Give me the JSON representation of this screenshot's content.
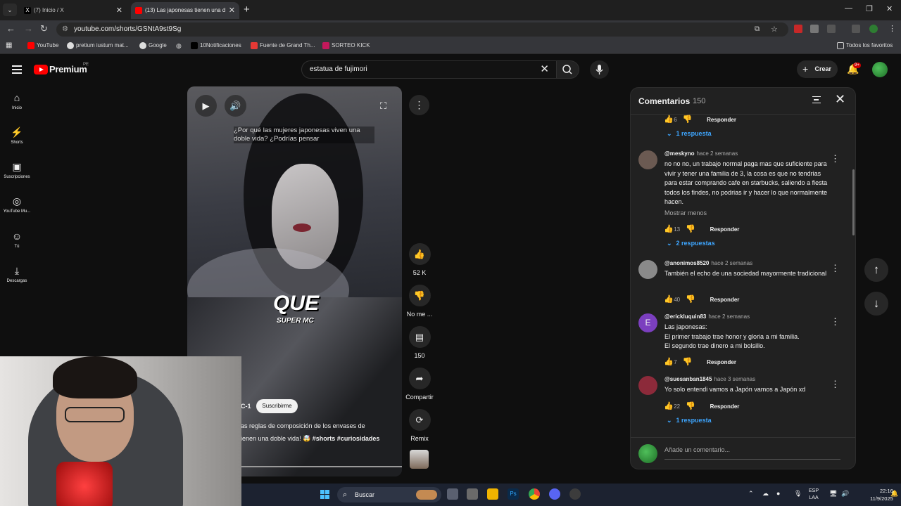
{
  "browser": {
    "tabs": [
      {
        "title": "(7) Inicio / X",
        "active": false
      },
      {
        "title": "(13) Las japonesas tienen una d",
        "active": true
      }
    ],
    "url": "youtube.com/shorts/GSNtA9st9Sg",
    "bookmarks": [
      "YouTube",
      "pretium iustum mat...",
      "Google",
      "10Notificaciones",
      "Fuente de Grand Th...",
      "SORTEO KICK"
    ],
    "all_bookmarks": "Todos los favoritos"
  },
  "youtube": {
    "brand": "Premium",
    "brand_region": "PE",
    "search_value": "estatua de fujimori",
    "create_label": "Crear",
    "notifications_badge": "9+",
    "sidebar": [
      {
        "label": "Inicio",
        "icon": "home-icon"
      },
      {
        "label": "Shorts",
        "icon": "shorts-icon"
      },
      {
        "label": "Suscripciones",
        "icon": "subscriptions-icon"
      },
      {
        "label": "YouTube Mu...",
        "icon": "music-icon"
      },
      {
        "label": "Tú",
        "icon": "you-icon"
      },
      {
        "label": "Descargas",
        "icon": "download-icon"
      }
    ]
  },
  "short": {
    "caption": "¿Por qué las mujeres japonesas viven una doble vida? ¿Podrías pensar",
    "overlay_big": "QUE",
    "overlay_small": "SUPER MC",
    "channel": "C-1",
    "subscribe": "Suscribirme",
    "description": "as reglas de composición de los envases de",
    "description2": "ienen una doble vida! 🤯",
    "hashtags": "#shorts #curiosidades",
    "actions": {
      "likes": "52 K",
      "dislike": "No me ...",
      "comments": "150",
      "share": "Compartir",
      "remix": "Remix"
    }
  },
  "comments_panel": {
    "title": "Comentarios",
    "count": "150",
    "top_partial": {
      "likes": "6",
      "reply": "Responder",
      "replies": "1 respuesta"
    },
    "comments": [
      {
        "user": "@meskyno",
        "time": "hace 2 semanas",
        "text": "no no no, un trabajo normal paga mas que suficiente para vivir y tener una familia de 3, la cosa es que no tendrias para estar comprando cafe en starbucks, saliendo a fiesta todos los findes, no podrias ir y hacer lo que normalmente hacen.",
        "more": "Mostrar menos",
        "likes": "13",
        "reply": "Responder",
        "replies": "2 respuestas",
        "avatar_color": "#6b5a52"
      },
      {
        "user": "@anonimos8520",
        "time": "hace 2 semanas",
        "text": "También el echo de una sociedad mayormente tradicional",
        "likes": "40",
        "reply": "Responder",
        "avatar_color": "#8a8a8a"
      },
      {
        "user": "@erickluquin83",
        "time": "hace 2 semanas",
        "text_lines": [
          "Las japonesas:",
          "El primer trabajo trae honor y gloria a mi familia.",
          "El segundo trae dinero a mi bolsillo."
        ],
        "likes": "7",
        "reply": "Responder",
        "avatar_letter": "E",
        "avatar_color": "#7b3fbf"
      },
      {
        "user": "@suesanban1845",
        "time": "hace 3 semanas",
        "text": "Yo solo entendi vamos a Japón vamos a Japón xd",
        "likes": "22",
        "reply": "Responder",
        "replies": "1 respuesta",
        "avatar_color": "#8c2a3a"
      }
    ],
    "add_placeholder": "Añade un comentario..."
  },
  "taskbar": {
    "search": "Buscar",
    "lang": "ESP",
    "lang2": "LAA",
    "time": "22:16",
    "date": "11/9/2025"
  }
}
